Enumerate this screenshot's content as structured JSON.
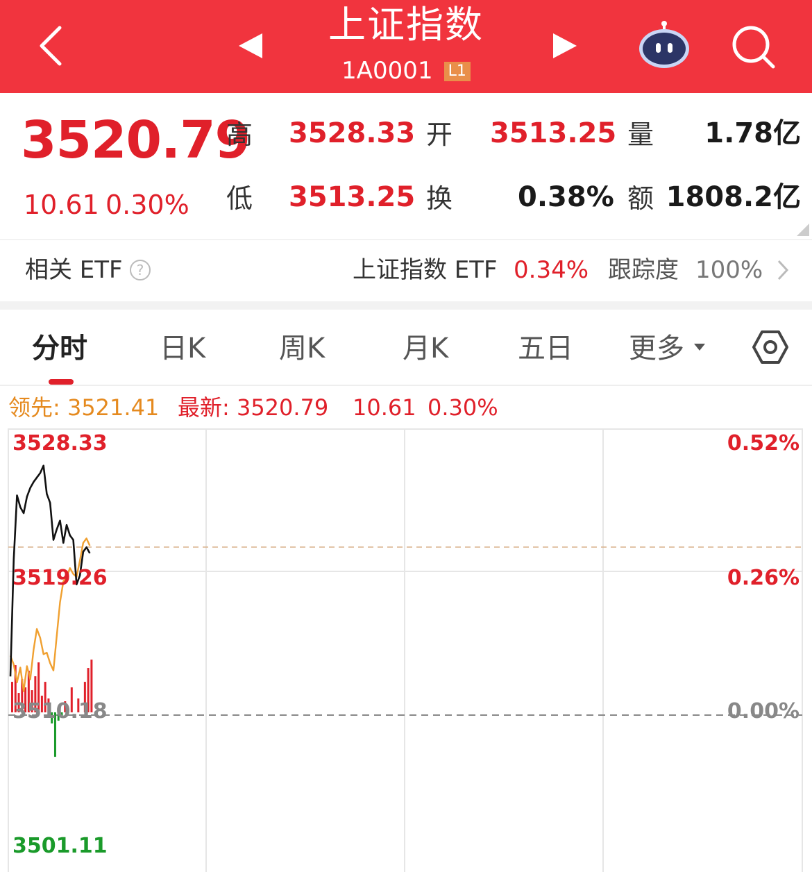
{
  "header": {
    "title": "上证指数",
    "code": "1A0001",
    "level": "L1"
  },
  "quote": {
    "price": "3520.79",
    "change": "10.61",
    "change_pct": "0.30%",
    "high_label": "高",
    "high": "3528.33",
    "open_label": "开",
    "open": "3513.25",
    "volume_label": "量",
    "volume": "1.78亿",
    "low_label": "低",
    "low": "3513.25",
    "turnover_label": "换",
    "turnover": "0.38%",
    "amount_label": "额",
    "amount": "1808.2亿"
  },
  "etf": {
    "label": "相关 ETF",
    "name": "上证指数 ETF",
    "pct": "0.34%",
    "track_label": "跟踪度",
    "track_value": "100%"
  },
  "tabs": [
    {
      "label": "分时",
      "active": true
    },
    {
      "label": "日K"
    },
    {
      "label": "周K"
    },
    {
      "label": "月K"
    },
    {
      "label": "五日"
    },
    {
      "label": "更多"
    }
  ],
  "info": {
    "lead": "领先: 3521.41",
    "latest": "最新: 3520.79",
    "latest_change": "10.61",
    "latest_pct": "0.30%"
  },
  "colors": {
    "header_bg": "#f1343e",
    "up": "#e0202a",
    "down": "#1a9a2a",
    "lead_line": "#f0a030",
    "price_line": "#111111"
  },
  "chart_data": {
    "type": "line",
    "y_left_ticks": [
      "3528.33",
      "3519.26",
      "3510.18",
      "3501.11"
    ],
    "y_right_ticks": [
      "0.52%",
      "0.26%",
      "0.00%"
    ],
    "ylim": [
      3501.11,
      3528.33
    ],
    "prev_close": 3510.18,
    "total_minutes": 240,
    "series": [
      {
        "key": "price",
        "color": "#111111",
        "points": [
          [
            0,
            3512.6
          ],
          [
            1,
            3520.5
          ],
          [
            2,
            3524.8
          ],
          [
            3,
            3524.0
          ],
          [
            4,
            3523.6
          ],
          [
            5,
            3524.7
          ],
          [
            6,
            3525.3
          ],
          [
            7,
            3525.7
          ],
          [
            8,
            3526.0
          ],
          [
            9,
            3526.3
          ],
          [
            10,
            3526.8
          ],
          [
            11,
            3524.9
          ],
          [
            12,
            3524.3
          ],
          [
            13,
            3521.8
          ],
          [
            14,
            3522.5
          ],
          [
            15,
            3523.1
          ],
          [
            16,
            3521.6
          ],
          [
            17,
            3522.8
          ],
          [
            18,
            3522.1
          ],
          [
            19,
            3521.8
          ],
          [
            20,
            3518.8
          ],
          [
            21,
            3519.4
          ],
          [
            22,
            3521.0
          ],
          [
            23,
            3521.3
          ],
          [
            24,
            3520.9
          ]
        ]
      },
      {
        "key": "lead",
        "color": "#f0a030",
        "points": [
          [
            0,
            3514.0
          ],
          [
            1,
            3513.4
          ],
          [
            2,
            3512.2
          ],
          [
            3,
            3513.2
          ],
          [
            4,
            3511.6
          ],
          [
            5,
            3513.3
          ],
          [
            6,
            3512.4
          ],
          [
            7,
            3514.4
          ],
          [
            8,
            3515.8
          ],
          [
            9,
            3515.2
          ],
          [
            10,
            3514.1
          ],
          [
            11,
            3514.2
          ],
          [
            12,
            3513.5
          ],
          [
            13,
            3513.0
          ],
          [
            14,
            3515.3
          ],
          [
            15,
            3517.6
          ],
          [
            16,
            3519.0
          ],
          [
            17,
            3519.3
          ],
          [
            18,
            3519.9
          ],
          [
            19,
            3519.5
          ],
          [
            20,
            3519.3
          ],
          [
            21,
            3520.4
          ],
          [
            22,
            3521.6
          ],
          [
            23,
            3521.9
          ],
          [
            24,
            3521.41
          ]
        ]
      }
    ],
    "bars": [
      {
        "x": 0,
        "v": 0.55
      },
      {
        "x": 1,
        "v": 0.85
      },
      {
        "x": 2,
        "v": 0.35
      },
      {
        "x": 3,
        "v": 0.6
      },
      {
        "x": 4,
        "v": 0.45
      },
      {
        "x": 5,
        "v": 0.75
      },
      {
        "x": 6,
        "v": 0.4
      },
      {
        "x": 7,
        "v": 0.65
      },
      {
        "x": 8,
        "v": 0.9
      },
      {
        "x": 9,
        "v": 0.3
      },
      {
        "x": 10,
        "v": 0.55
      },
      {
        "x": 11,
        "v": 0.25
      },
      {
        "x": 12,
        "v": -0.2
      },
      {
        "x": 13,
        "v": -0.8
      },
      {
        "x": 14,
        "v": -0.15
      },
      {
        "x": 15,
        "v": -0.1
      },
      {
        "x": 16,
        "v": 0.2
      },
      {
        "x": 18,
        "v": 0.45
      },
      {
        "x": 20,
        "v": 0.25
      },
      {
        "x": 22,
        "v": 0.55
      },
      {
        "x": 23,
        "v": 0.8
      },
      {
        "x": 24,
        "v": 0.95
      }
    ]
  }
}
